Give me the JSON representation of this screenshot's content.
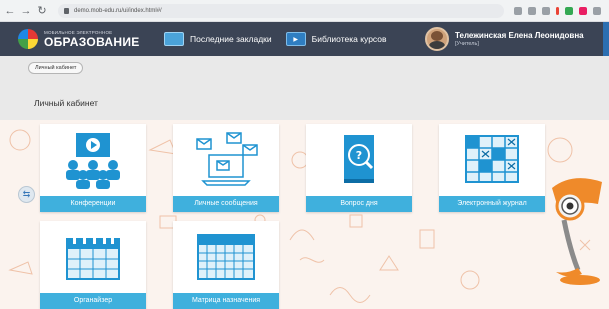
{
  "browser": {
    "url": "demo.mob-edu.ru/ui/index.html#/",
    "back_icon": "arrow-left-icon",
    "forward_icon": "arrow-right-icon",
    "reload_icon": "reload-icon"
  },
  "header": {
    "logo_small": "МОБИЛЬНОЕ ЭЛЕКТРОННОЕ",
    "logo_big": "ОБРАЗОВАНИЕ",
    "menu": [
      {
        "label": "Последние закладки",
        "icon": "bookmarks-icon"
      },
      {
        "label": "Библиотека курсов",
        "icon": "course-library-icon"
      }
    ],
    "user": {
      "name": "Тележинская Елена Леонидовна",
      "role": "[Учитель]"
    }
  },
  "breadcrumb": "Личный кабинет",
  "page_title": "Личный кабинет",
  "tiles": [
    {
      "label": "Конференции",
      "icon": "conference-icon"
    },
    {
      "label": "Личные сообщения",
      "icon": "messages-icon"
    },
    {
      "label": "Вопрос дня",
      "icon": "question-of-day-icon"
    },
    {
      "label": "Электронный журнал",
      "icon": "gradebook-icon"
    },
    {
      "label": "Органайзер",
      "icon": "organizer-icon"
    },
    {
      "label": "Матрица назначения",
      "icon": "assignment-matrix-icon"
    }
  ],
  "colors": {
    "header_bg": "#3b4455",
    "tile_label_bg": "#3fb0dd",
    "tile_icon_blue": "#1f93d1"
  }
}
